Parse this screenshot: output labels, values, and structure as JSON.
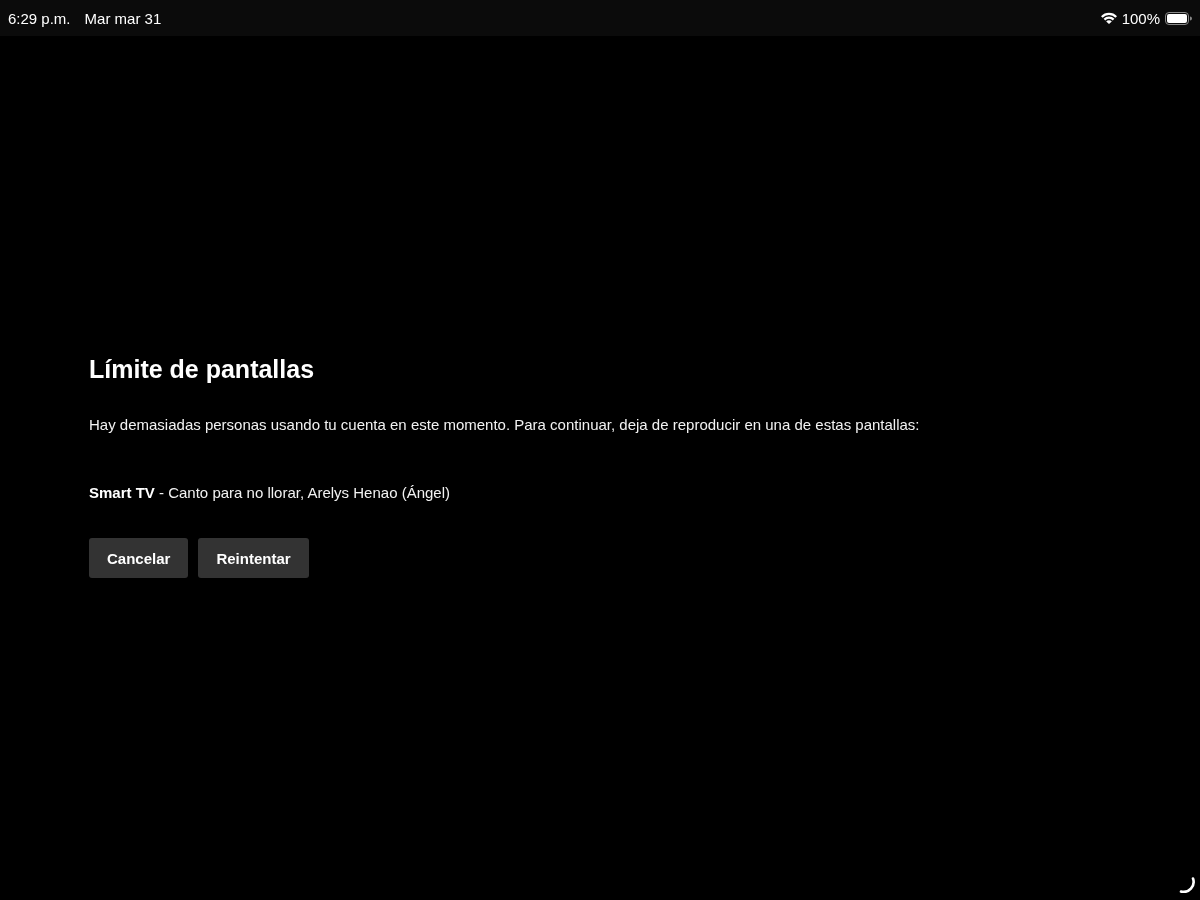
{
  "status_bar": {
    "time": "6:29 p.m.",
    "date": "Mar mar 31",
    "battery": "100%"
  },
  "dialog": {
    "title": "Límite de pantallas",
    "message": "Hay demasiadas personas usando tu cuenta en este momento. Para continuar, deja de reproducir en una de estas pantallas:",
    "devices": [
      {
        "text": "**Smart TV** - Canto para no llorar, Arelys Henao (Ángel)"
      }
    ],
    "buttons": [
      {
        "label": "Cancelar"
      },
      {
        "label": "Reintentar"
      }
    ]
  }
}
